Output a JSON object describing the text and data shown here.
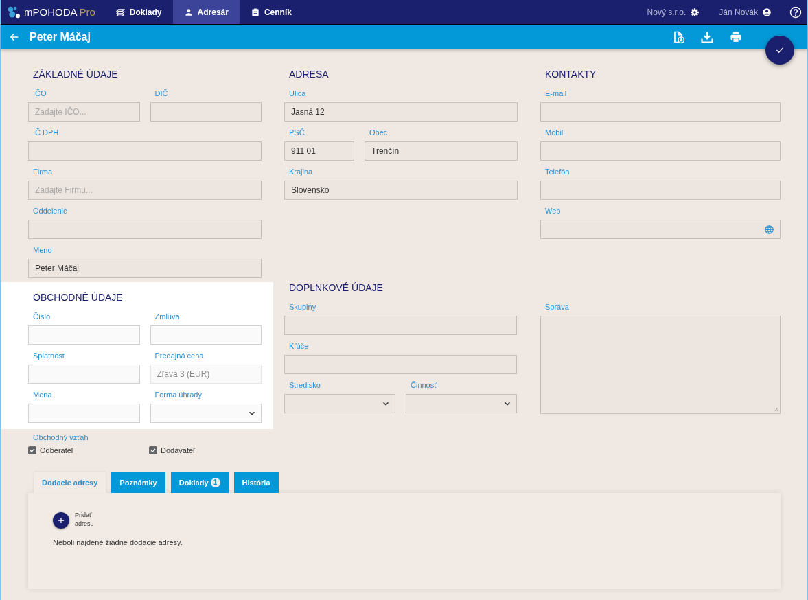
{
  "app": {
    "name": "mPOHODA",
    "edition": "Pro"
  },
  "nav": [
    {
      "label": "Doklady",
      "selected": false
    },
    {
      "label": "Adresár",
      "selected": true
    },
    {
      "label": "Cenník",
      "selected": false
    }
  ],
  "account": {
    "company": "Nový s.r.o.",
    "user": "Ján Novák"
  },
  "title": "Peter Máčaj",
  "sections": [
    {
      "title": "ZÁKLADNÉ ÚDAJE",
      "highlighted": false,
      "columns": [
        [
          [
            {
              "label": "IČO",
              "kind": "text",
              "placeholder": "Zadajte IČO...",
              "disabled": false
            },
            {
              "label": "DIČ",
              "kind": "text",
              "disabled": false
            }
          ],
          [
            {
              "label": "IČ DPH",
              "kind": "text",
              "disabled": false
            }
          ],
          [
            {
              "label": "Firma",
              "kind": "text",
              "placeholder": "Zadajte Firmu...",
              "disabled": false
            }
          ],
          [
            {
              "label": "Oddelenie",
              "kind": "text",
              "disabled": false
            }
          ],
          [
            {
              "label": "Meno",
              "kind": "text",
              "value": "Peter  Máčaj",
              "disabled": false
            }
          ]
        ]
      ]
    },
    {
      "title": "ADRESA",
      "highlighted": false,
      "columns": [
        [
          [
            {
              "label": "Ulica",
              "kind": "text",
              "value": "Jasná 12",
              "disabled": false
            }
          ],
          [
            {
              "label": "PSČ",
              "kind": "postal",
              "value": "911 01",
              "disabled": false
            },
            {
              "label": "Obec",
              "kind": "text",
              "value": "Trenčín",
              "disabled": false
            }
          ],
          [
            {
              "label": "Krajina",
              "kind": "text",
              "value": "Slovensko",
              "disabled": false
            }
          ]
        ]
      ]
    },
    {
      "title": "KONTAKTY",
      "highlighted": false,
      "columns": [
        [
          [
            {
              "label": "E-mail",
              "kind": "text",
              "disabled": false
            }
          ],
          [
            {
              "label": "Mobil",
              "kind": "text",
              "disabled": false
            }
          ],
          [
            {
              "label": "Telefón",
              "kind": "text",
              "disabled": false
            }
          ],
          [
            {
              "label": "Web",
              "kind": "url",
              "disabled": false
            }
          ]
        ]
      ]
    },
    {
      "title": "OBCHODNÉ ÚDAJE",
      "highlighted": true,
      "columns": [
        [
          [
            {
              "label": "Číslo",
              "kind": "text",
              "disabled": false
            },
            {
              "label": "Zmluva",
              "kind": "text",
              "disabled": false
            }
          ],
          [
            {
              "label": "Splatnosť",
              "kind": "text",
              "disabled": false
            },
            {
              "label": "Predajná cena",
              "kind": "text",
              "value": "Zľava 3 (EUR)",
              "disabled": true
            }
          ],
          [
            {
              "label": "Mena",
              "kind": "text",
              "disabled": false
            },
            {
              "label": "Forma úhrady",
              "kind": "select",
              "disabled": false
            }
          ]
        ]
      ]
    },
    {
      "title": "DOPLNKOVÉ ÚDAJE",
      "highlighted": false,
      "columns": [
        [
          [
            {
              "label": "Skupiny",
              "kind": "text",
              "disabled": false
            }
          ],
          [
            {
              "label": "Kľúče",
              "kind": "text",
              "disabled": false
            }
          ],
          [
            {
              "label": "Stredisko",
              "kind": "select",
              "disabled": false
            },
            {
              "label": "Činnosť",
              "kind": "select",
              "disabled": false
            }
          ]
        ],
        [
          [
            {
              "label": "Správa",
              "kind": "textarea",
              "disabled": false
            }
          ]
        ]
      ]
    }
  ],
  "relationship": {
    "label": "Obchodný vzťah",
    "options": [
      {
        "label": "Odberateľ",
        "checked": true
      },
      {
        "label": "Dodávateľ",
        "checked": true
      }
    ]
  },
  "tabs": [
    {
      "label": "Dodacie adresy",
      "selected": true
    },
    {
      "label": "Poznámky",
      "selected": false
    },
    {
      "label": "Doklady",
      "badge": "1",
      "selected": false
    },
    {
      "label": "História",
      "selected": false
    }
  ],
  "panel": {
    "add_label": "Pridať adresu",
    "message": "Neboli nájdené žiadne dodacie adresy."
  }
}
